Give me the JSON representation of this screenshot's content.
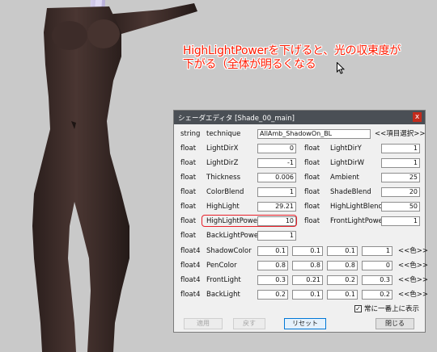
{
  "annotation": {
    "line1": "HighLightPowerを下げると、光の収束度が",
    "line2": "下がる（全体が明るくなる",
    "color": "#ff1a00"
  },
  "dialog": {
    "title": "シェーダエディタ [Shade_00_main]",
    "close_glyph": "x",
    "technique_row": {
      "type": "string",
      "name": "technique",
      "value": "AllAmb_ShadowOn_BL",
      "select_label": "<<項目選択>>"
    },
    "params": [
      {
        "type": "float",
        "name": "LightDirX",
        "value": "0"
      },
      {
        "type": "float",
        "name": "LightDirY",
        "value": "1"
      },
      {
        "type": "float",
        "name": "LightDirZ",
        "value": "-1"
      },
      {
        "type": "float",
        "name": "LightDirW",
        "value": "1"
      },
      {
        "type": "float",
        "name": "Thickness",
        "value": "0.006"
      },
      {
        "type": "float",
        "name": "Ambient",
        "value": "25"
      },
      {
        "type": "float",
        "name": "ColorBlend",
        "value": "1"
      },
      {
        "type": "float",
        "name": "ShadeBlend",
        "value": "20"
      },
      {
        "type": "float",
        "name": "HighLight",
        "value": "29.21"
      },
      {
        "type": "float",
        "name": "HighLightBlend",
        "value": "50"
      },
      {
        "type": "float",
        "name": "HighLightPower",
        "value": "10"
      },
      {
        "type": "float",
        "name": "FrontLightPower",
        "value": "1"
      },
      {
        "type": "float",
        "name": "BackLightPower",
        "value": "1"
      }
    ],
    "colors": [
      {
        "type": "float4",
        "name": "ShadowColor",
        "values": [
          "0.1",
          "0.1",
          "0.1",
          "1"
        ],
        "label": "<<色>>"
      },
      {
        "type": "float4",
        "name": "PenColor",
        "values": [
          "0.8",
          "0.8",
          "0.8",
          "0"
        ],
        "label": "<<色>>"
      },
      {
        "type": "float4",
        "name": "FrontLight",
        "values": [
          "0.3",
          "0.21",
          "0.2",
          "0.3"
        ],
        "label": "<<色>>"
      },
      {
        "type": "float4",
        "name": "BackLight",
        "values": [
          "0.2",
          "0.1",
          "0.1",
          "0.2"
        ],
        "label": "<<色>>"
      }
    ],
    "always_on_top": {
      "label": "常に一番上に表示",
      "checked": true
    },
    "buttons": {
      "apply": "適用",
      "revert": "戻す",
      "reset": "リセット",
      "close": "閉じる"
    },
    "highlight_color": "#e8202a"
  }
}
